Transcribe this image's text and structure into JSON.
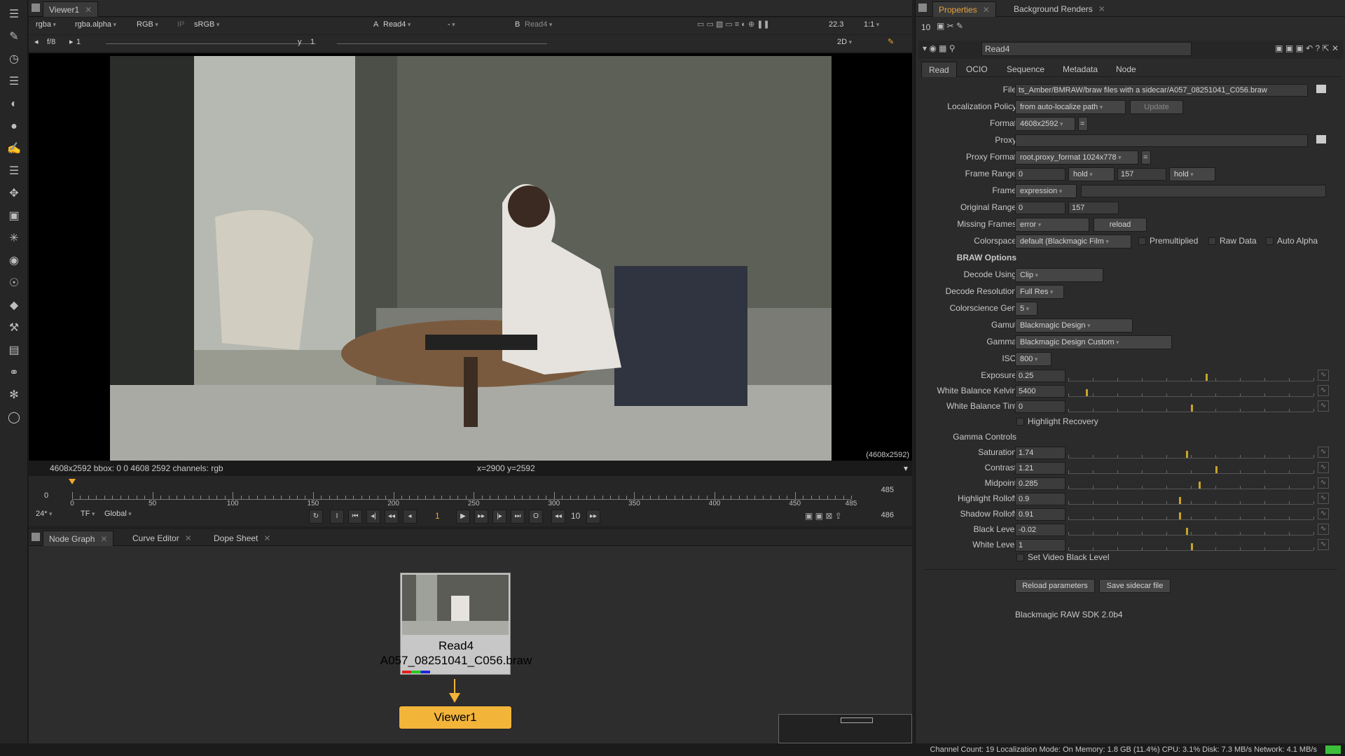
{
  "viewer": {
    "tab_label": "Viewer1",
    "channels": "rgba",
    "alpha": "rgba.alpha",
    "color_channels": "RGB",
    "ip": "IP",
    "lut": "sRGB",
    "a_label": "A",
    "a_input": "Read4",
    "dash": "-",
    "b_label": "B",
    "b_input": "Read4",
    "zoom": "22.3",
    "ratio": "1:1",
    "fstop": "f/8",
    "frame_field": "1",
    "y_label": "y",
    "y_value": "1",
    "view_mode": "2D",
    "resolution_label": "(4608x2592)",
    "info_left": "4608x2592  bbox: 0 0 4608 2592 channels: rgb",
    "info_coords": "x=2900 y=2592"
  },
  "timeline": {
    "start": "0",
    "end_top": "485",
    "end_bottom": "486",
    "labels": [
      "0",
      "50",
      "100",
      "150",
      "200",
      "250",
      "300",
      "350",
      "400",
      "450",
      "485"
    ],
    "fps": "24*",
    "tf": "TF",
    "range_mode": "Global",
    "current_frame": "1",
    "increment": "10",
    "playhead_frame": 0
  },
  "nodegraph": {
    "tabs": [
      "Node Graph",
      "Curve Editor",
      "Dope Sheet"
    ],
    "read_node_name": "Read4",
    "read_node_file": "A057_08251041_C056.braw",
    "viewer_node_name": "Viewer1"
  },
  "props": {
    "tabs": [
      "Properties",
      "Background Renders"
    ],
    "count": "10",
    "node_name": "Read4",
    "sub_tabs": [
      "Read",
      "OCIO",
      "Sequence",
      "Metadata",
      "Node"
    ],
    "file_label": "File",
    "file_value": "ts_Amber/BMRAW/braw files with a sidecar/A057_08251041_C056.braw",
    "localization_label": "Localization Policy",
    "localization_value": "from auto-localize path",
    "update_btn": "Update",
    "format_label": "Format",
    "format_value": "4608x2592",
    "proxy_label": "Proxy",
    "proxy_format_label": "Proxy Format",
    "proxy_format_value": "root.proxy_format 1024x778",
    "frame_range_label": "Frame Range",
    "frame_range_start": "0",
    "frame_range_hold1": "hold",
    "frame_range_end": "157",
    "frame_range_hold2": "hold",
    "frame_label": "Frame",
    "frame_value": "expression",
    "original_range_label": "Original Range",
    "original_range_start": "0",
    "original_range_end": "157",
    "missing_frames_label": "Missing Frames",
    "missing_frames_value": "error",
    "reload_btn": "reload",
    "colorspace_label": "Colorspace",
    "colorspace_value": "default (Blackmagic Film",
    "premultiplied": "Premultiplied",
    "raw_data": "Raw Data",
    "auto_alpha": "Auto Alpha",
    "braw_header": "BRAW Options",
    "decode_using_label": "Decode Using",
    "decode_using_value": "Clip",
    "decode_res_label": "Decode Resolution",
    "decode_res_value": "Full Res",
    "colorscience_label": "Colorscience Gen",
    "colorscience_value": "5",
    "gamut_label": "Gamut",
    "gamut_value": "Blackmagic Design",
    "gamma_label": "Gamma",
    "gamma_value": "Blackmagic Design Custom",
    "iso_label": "ISO",
    "iso_value": "800",
    "sliders1": [
      {
        "label": "Exposure",
        "value": "0.25",
        "pos": 0.56
      },
      {
        "label": "White Balance Kelvin",
        "value": "5400",
        "pos": 0.07
      },
      {
        "label": "White Balance Tint",
        "value": "0",
        "pos": 0.5
      }
    ],
    "highlight_recovery": "Highlight Recovery",
    "gamma_controls": "Gamma Controls",
    "sliders2": [
      {
        "label": "Saturation",
        "value": "1.74",
        "pos": 0.48
      },
      {
        "label": "Contrast",
        "value": "1.21",
        "pos": 0.6
      },
      {
        "label": "Midpoint",
        "value": "0.285",
        "pos": 0.53
      },
      {
        "label": "Highlight Rolloff",
        "value": "0.9",
        "pos": 0.45
      },
      {
        "label": "Shadow Rolloff",
        "value": "0.91",
        "pos": 0.45
      },
      {
        "label": "Black Level",
        "value": "-0.02",
        "pos": 0.48
      },
      {
        "label": "White Level",
        "value": "1",
        "pos": 0.5
      }
    ],
    "set_video_black": "Set Video Black Level",
    "reload_params_btn": "Reload parameters",
    "save_sidecar_btn": "Save sidecar file",
    "sdk": "Blackmagic RAW SDK 2.0b4"
  },
  "status": "Channel Count: 19  Localization Mode: On  Memory: 1.8 GB (11.4%)  CPU: 3.1%  Disk: 7.3 MB/s  Network: 4.1 MB/s",
  "colors": {
    "accent": "#f0a830",
    "node_read": "#c7c7c7",
    "node_viewer": "#f3b43a",
    "tab_active": "#e8a33a"
  }
}
